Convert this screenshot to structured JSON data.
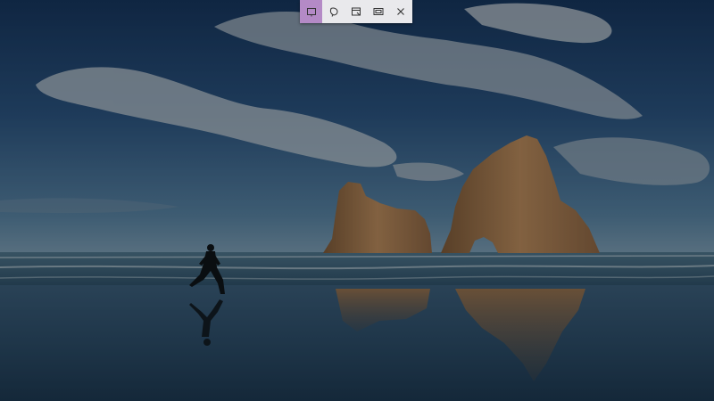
{
  "desktop": {
    "wallpaper_description_colors": {
      "sky_top": "#1b3d68",
      "sky_mid": "#2f5a86",
      "horizon": "#6c8fa8",
      "sea": "#3c5f76",
      "sand": "#243d55",
      "rock": "#a4784a"
    },
    "dim_overlay_color": "#000000"
  },
  "snip_toolbar": {
    "accent": "#b48ac6",
    "background": "#e9e9ec",
    "buttons": [
      {
        "icon": "rectangular-snip-icon",
        "selected": true
      },
      {
        "icon": "freeform-snip-icon",
        "selected": false
      },
      {
        "icon": "window-snip-icon",
        "selected": false
      },
      {
        "icon": "fullscreen-snip-icon",
        "selected": false
      },
      {
        "icon": "close-icon",
        "selected": false
      }
    ]
  }
}
